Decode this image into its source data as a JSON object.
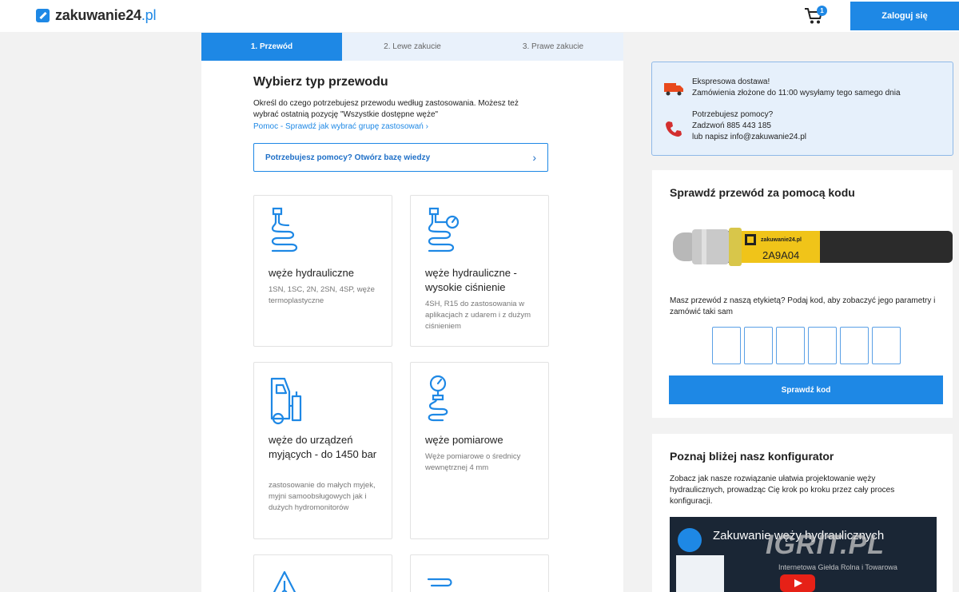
{
  "header": {
    "logo_main": "zakuwanie24",
    "logo_suffix": ".pl",
    "cart_count": "1",
    "login_label": "Zaloguj się"
  },
  "steps": [
    {
      "label": "1. Przewód",
      "active": true
    },
    {
      "label": "2. Lewe zakucie",
      "active": false
    },
    {
      "label": "3. Prawe zakucie",
      "active": false
    }
  ],
  "main": {
    "title": "Wybierz typ przewodu",
    "description": "Określ do czego potrzebujesz przewodu według zastosowania. Możesz też wybrać ostatnią pozycję \"Wszystkie dostępne węże\"",
    "help_link": "Pomoc - Sprawdź jak wybrać grupę zastosowań",
    "kb_label": "Potrzebujesz pomocy? Otwórz bazę wiedzy"
  },
  "cards": [
    {
      "title": "węże hydrauliczne",
      "subtitle": "1SN, 1SC, 2N, 2SN, 4SP, węże termoplastyczne",
      "icon": "hydraulic-hose-icon"
    },
    {
      "title": "węże hydrauliczne - wysokie ciśnienie",
      "subtitle": "4SH, R15 do zastosowania w aplikacjach z udarem i z dużym ciśnieniem",
      "icon": "high-pressure-hose-icon"
    },
    {
      "title": "węże do urządzeń myjących - do 1450 bar",
      "subtitle": "zastosowanie do małych myjek, myjni samoobsługowych jak i dużych hydromonitorów",
      "icon": "pressure-washer-icon"
    },
    {
      "title": "węże pomiarowe",
      "subtitle": "Węże pomiarowe o średnicy wewnętrznej 4 mm",
      "icon": "gauge-hose-icon"
    }
  ],
  "info": {
    "delivery_title": "Ekspresowa dostawa!",
    "delivery_text": "Zamówienia złożone do 11:00 wysyłamy tego samego dnia",
    "help_title": "Potrzebujesz pomocy?",
    "help_phone": "Zadzwoń 885 443 185",
    "help_email": "lub napisz info@zakuwanie24.pl"
  },
  "code_panel": {
    "title": "Sprawdź przewód za pomocą kodu",
    "label_brand": "zakuwanie24.pl",
    "label_code": "2A9A04",
    "description": "Masz przewód z naszą etykietą? Podaj kod, aby zobaczyć jego parametry i zamówić taki sam",
    "button_label": "Sprawdź kod"
  },
  "config_panel": {
    "title": "Poznaj bliżej nasz konfigurator",
    "description": "Zobacz jak nasze rozwiązanie ułatwia projektowanie węży hydraulicznych, prowadząc Cię krok po kroku przez cały proces konfiguracji.",
    "video_title": "Zakuwanie węży hydraulicznych",
    "watermark": "IGRIT.PL",
    "watermark_sub": "Internetowa Giełda Rolna i Towarowa"
  },
  "colors": {
    "accent": "#1e88e5",
    "info_bg": "#e6f0fb",
    "page_bg": "#f2f2f2"
  }
}
